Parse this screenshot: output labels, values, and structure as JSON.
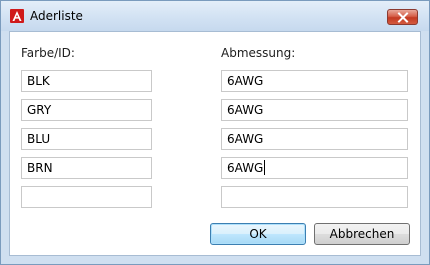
{
  "window": {
    "title": "Aderliste"
  },
  "columns": {
    "left_label": "Farbe/ID:",
    "right_label": "Abmessung:"
  },
  "rows": [
    {
      "color": "BLK",
      "size": "6AWG"
    },
    {
      "color": "GRY",
      "size": "6AWG"
    },
    {
      "color": "BLU",
      "size": "6AWG"
    },
    {
      "color": "BRN",
      "size": "6AWG"
    },
    {
      "color": "",
      "size": ""
    }
  ],
  "buttons": {
    "ok_label": "OK",
    "cancel_label": "Abbrechen"
  },
  "icons": {
    "app": "autocad-logo-icon",
    "close": "close-icon"
  },
  "colors": {
    "title_bar": "#cfdff0",
    "close_button": "#c33a22",
    "ok_border": "#3c7fb1"
  }
}
